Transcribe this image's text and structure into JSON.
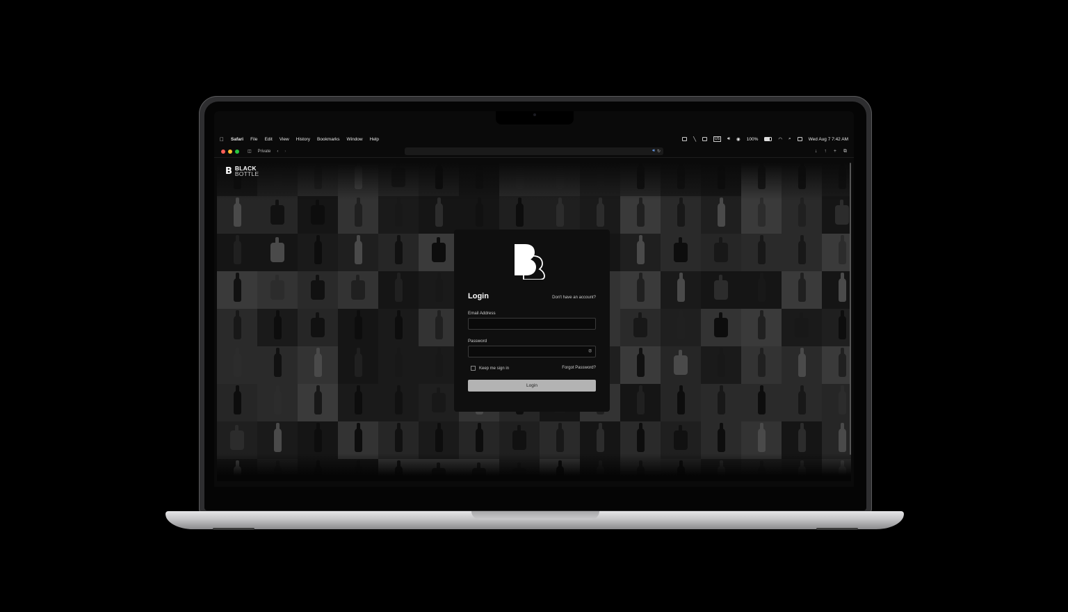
{
  "menubar": {
    "app": "Safari",
    "items": [
      "File",
      "Edit",
      "View",
      "History",
      "Bookmarks",
      "Window",
      "Help"
    ],
    "battery": "100%",
    "datetime": "Wed Aug 7  7:42 AM",
    "keyboard": "US"
  },
  "toolbar": {
    "private_label": "Private"
  },
  "brand": {
    "line1": "BLACK",
    "line2": "BOTTLE"
  },
  "login": {
    "title": "Login",
    "signup_link": "Don't have an account?",
    "email_label": "Email Address",
    "email_value": "",
    "password_label": "Password",
    "password_value": "",
    "keep_signed_in": "Keep me sign in",
    "forgot": "Forgot Password?",
    "submit": "Login"
  },
  "colors": {
    "background": "#0c0c0c",
    "card": "#0f0f0f",
    "button": "#b3b3b3",
    "accent_red": "#ff5f57",
    "accent_yellow": "#febc2e",
    "accent_green": "#28c840"
  }
}
